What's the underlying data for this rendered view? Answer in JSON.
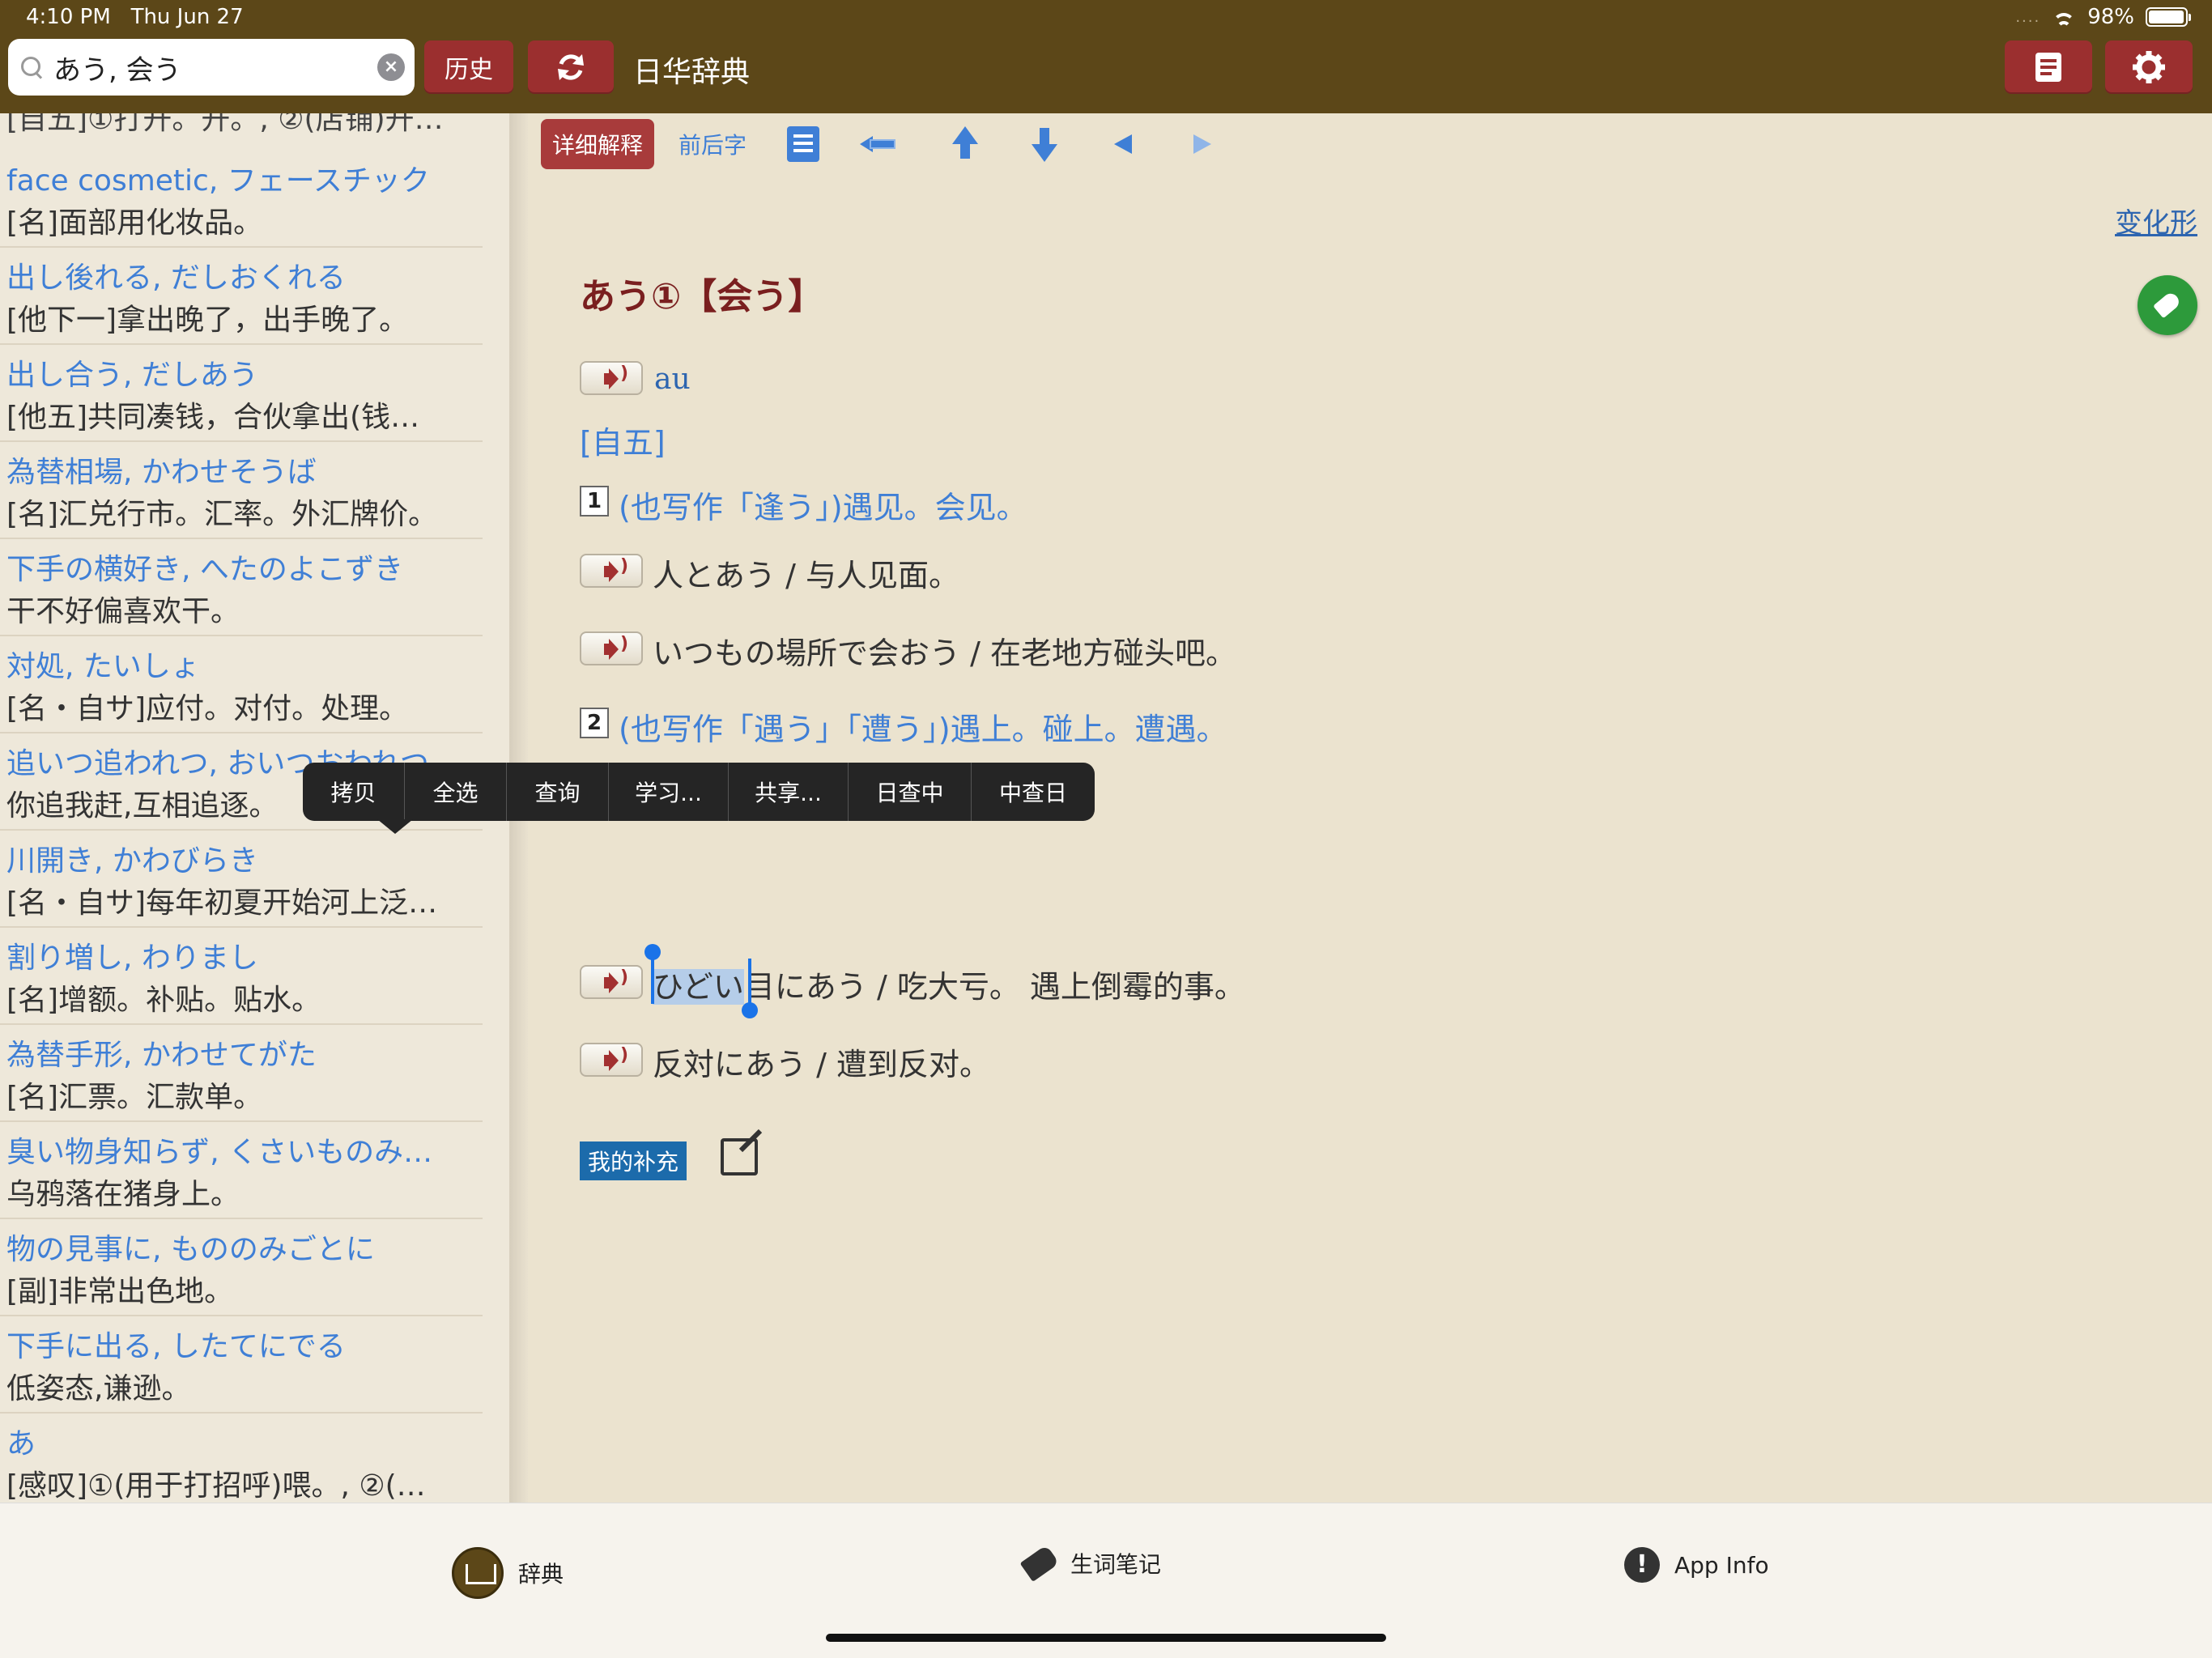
{
  "status_bar": {
    "time": "4:10 PM",
    "date": "Thu Jun 27",
    "battery": "98%",
    "battery_level": 0.98
  },
  "search": {
    "value": "あう, 会う",
    "placeholder": ""
  },
  "header": {
    "history_label": "历史",
    "title": "日华辞典"
  },
  "left_list": {
    "partial_top": "[自五]①打开。开。, ②(店铺)开…",
    "items": [
      {
        "term": "face cosmetic, フェースチック",
        "def": "[名]面部用化妆品。"
      },
      {
        "term": "出し後れる, だしおくれる",
        "def": "[他下一]拿出晚了，出手晚了。"
      },
      {
        "term": "出し合う, だしあう",
        "def": "[他五]共同凑钱，合伙拿出(钱…"
      },
      {
        "term": "為替相場, かわせそうば",
        "def": "[名]汇兑行市。汇率。外汇牌价。"
      },
      {
        "term": "下手の横好き, へたのよこずき",
        "def": "干不好偏喜欢干。"
      },
      {
        "term": "対処, たいしょ",
        "def": "[名・自サ]应付。对付。处理。"
      },
      {
        "term": "追いつ追われつ, おいつおわれつ",
        "def": "你追我赶,互相追逐。"
      },
      {
        "term": "川開き, かわびらき",
        "def": "[名・自サ]每年初夏开始河上泛…"
      },
      {
        "term": "割り増し, わりまし",
        "def": "[名]增额。补贴。贴水。"
      },
      {
        "term": "為替手形, かわせてがた",
        "def": "[名]汇票。汇款单。"
      },
      {
        "term": "臭い物身知らず, くさいものみ…",
        "def": "乌鸦落在猪身上。"
      },
      {
        "term": "物の見事に, もののみごとに",
        "def": "[副]非常出色地。"
      },
      {
        "term": "下手に出る, したてにでる",
        "def": "低姿态,谦逊。"
      },
      {
        "term": "あ",
        "def": "[感叹]①(用于打招呼)喂。, ②(…"
      }
    ]
  },
  "toolbar": {
    "detail_label": "详细解释",
    "context_label": "前后字",
    "icons": [
      "document-icon",
      "swap-icon",
      "up-arrow-icon",
      "down-arrow-icon",
      "left-triangle-icon",
      "right-triangle-icon"
    ]
  },
  "entry": {
    "conjugation_link": "变化形",
    "headword": "あう①【会う】",
    "romaji": "au",
    "pos": "[自五]",
    "senses": [
      {
        "num": "1",
        "text": "(也写作「逢う」)遇见。会见。",
        "examples": [
          {
            "text": "人とあう / 与人见面。"
          },
          {
            "text": "いつもの場所で会おう / 在老地方碰头吧。"
          }
        ]
      },
      {
        "num": "2",
        "text": "(也写作「遇う」「遭う」)遇上。碰上。遭遇。",
        "examples": [
          {
            "selected": "ひどい",
            "text": "目にあう / 吃大亏。 遇上倒霉的事。"
          },
          {
            "text": "反対にあう / 遭到反对。"
          }
        ]
      }
    ],
    "supplement_label": "我的补充"
  },
  "context_menu": {
    "items": [
      "拷贝",
      "全选",
      "查询",
      "学习...",
      "共享...",
      "日查中",
      "中查日"
    ]
  },
  "tabbar": {
    "tabs": [
      {
        "label": "辞典",
        "icon": "book-icon"
      },
      {
        "label": "生词笔记",
        "icon": "tag-icon"
      },
      {
        "label": "App Info",
        "icon": "info-icon"
      }
    ]
  },
  "colors": {
    "header_bg": "#5c4718",
    "button_red": "#9b2f2f",
    "link_blue": "#3f7fd6",
    "headword_red": "#7a1f1f",
    "supplement_bg": "#1c6bab",
    "tag_green": "#2d9a3b"
  }
}
